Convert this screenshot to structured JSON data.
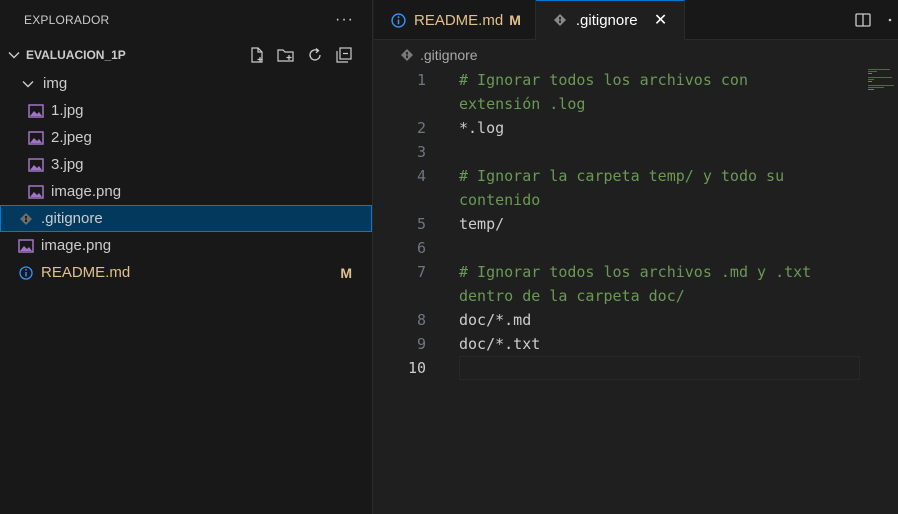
{
  "sidebar": {
    "title": "EXPLORADOR",
    "more": "···",
    "root_folder": "EVALUACION_1P",
    "items": [
      {
        "label": "img",
        "kind": "folder"
      },
      {
        "label": "1.jpg",
        "kind": "image"
      },
      {
        "label": "2.jpeg",
        "kind": "image"
      },
      {
        "label": "3.jpg",
        "kind": "image"
      },
      {
        "label": "image.png",
        "kind": "image"
      },
      {
        "label": ".gitignore",
        "kind": "git"
      },
      {
        "label": "image.png",
        "kind": "image"
      },
      {
        "label": "README.md",
        "kind": "info",
        "badge": "M"
      }
    ]
  },
  "tabs": [
    {
      "label": "README.md",
      "badge": "M"
    },
    {
      "label": ".gitignore",
      "close": "✕"
    }
  ],
  "breadcrumb": {
    "file": ".gitignore"
  },
  "editor": {
    "lines": [
      {
        "num": "1",
        "text": "# Ignorar todos los archivos con",
        "wrap": "extensión .log",
        "comment": true
      },
      {
        "num": "2",
        "text": "*.log"
      },
      {
        "num": "3",
        "text": ""
      },
      {
        "num": "4",
        "text": "# Ignorar la carpeta temp/ y todo su",
        "wrap": "contenido",
        "comment": true
      },
      {
        "num": "5",
        "text": "temp/"
      },
      {
        "num": "6",
        "text": ""
      },
      {
        "num": "7",
        "text": "# Ignorar todos los archivos .md y .txt",
        "wrap": "dentro de la carpeta doc/",
        "comment": true
      },
      {
        "num": "8",
        "text": "doc/*.md"
      },
      {
        "num": "9",
        "text": "doc/*.txt"
      },
      {
        "num": "10",
        "text": ""
      }
    ]
  },
  "colors": {
    "accent": "#0078d4",
    "modified": "#e2c08d",
    "comment": "#6a9955",
    "image_icon": "#a074c4",
    "info_icon": "#3794ff"
  }
}
